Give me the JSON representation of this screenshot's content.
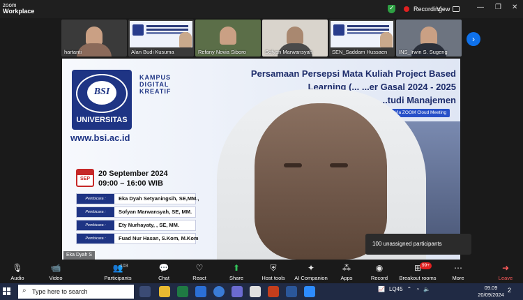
{
  "titlebar": {
    "app_line1": "zoom",
    "app_line2": "Workplace",
    "recording": "Recording",
    "view": "View",
    "min": "—",
    "max": "❐",
    "close": "✕"
  },
  "thumbnails": [
    {
      "name": "hartanti",
      "kind": "person"
    },
    {
      "name": "Alan Budi Kusuma",
      "kind": "presentation"
    },
    {
      "name": "Refany Novia Siboro",
      "kind": "person"
    },
    {
      "name": "Sofyan Marwansyah",
      "kind": "person"
    },
    {
      "name": "SEN_Saddam Hussaen",
      "kind": "presentation"
    },
    {
      "name": "INS_Irwin S. Sugeng",
      "kind": "person"
    }
  ],
  "slide": {
    "uni_name": "UNIVERSITAS",
    "logo_text": "BSI",
    "campus_tag": [
      "KAMPUS",
      "DIGITAL",
      "KREATIF"
    ],
    "website": "www.bsi.ac.id",
    "title_line1": "Persamaan Persepsi Mata Kuliah Project Based",
    "title_line2": "Learning (... ...er Gasal 2024 - 2025",
    "title_line3": "...tudi Manajemen",
    "zoom_tag": "Via ZOOM Cloud Meeting",
    "cal_label": "SEP",
    "date": "20 September 2024",
    "time": "09:00 – 16:00 WIB",
    "speakers": [
      {
        "role": "Pembicara :",
        "name": "Eka Dyah Setyaningsih, SE,MM.,"
      },
      {
        "role": "Pembicara :",
        "name": "Sofyan Marwansyah, SE, MM."
      },
      {
        "role": "Pembicara :",
        "name": "Ety Nurhayaty, , SE, MM."
      },
      {
        "role": "Pembicara :",
        "name": "Fuad Nur Hasan, S.Kom, M.Kom"
      }
    ]
  },
  "speaker_label": "Eka Dyah S",
  "tooltip": "100 unassigned participants",
  "toolbar": {
    "audio": "Audio",
    "video": "Video",
    "participants": "Participants",
    "participants_count": "103",
    "chat": "Chat",
    "react": "React",
    "share": "Share",
    "host_tools": "Host tools",
    "ai_companion": "AI Companion",
    "apps": "Apps",
    "record": "Record",
    "breakout": "Breakout rooms",
    "breakout_badge": "99+",
    "more": "More",
    "leave": "Leave"
  },
  "taskbar": {
    "search_placeholder": "Type here to search",
    "weather": "LQ45",
    "time": "09.09",
    "date": "20/09/2024",
    "notifications": "2"
  }
}
